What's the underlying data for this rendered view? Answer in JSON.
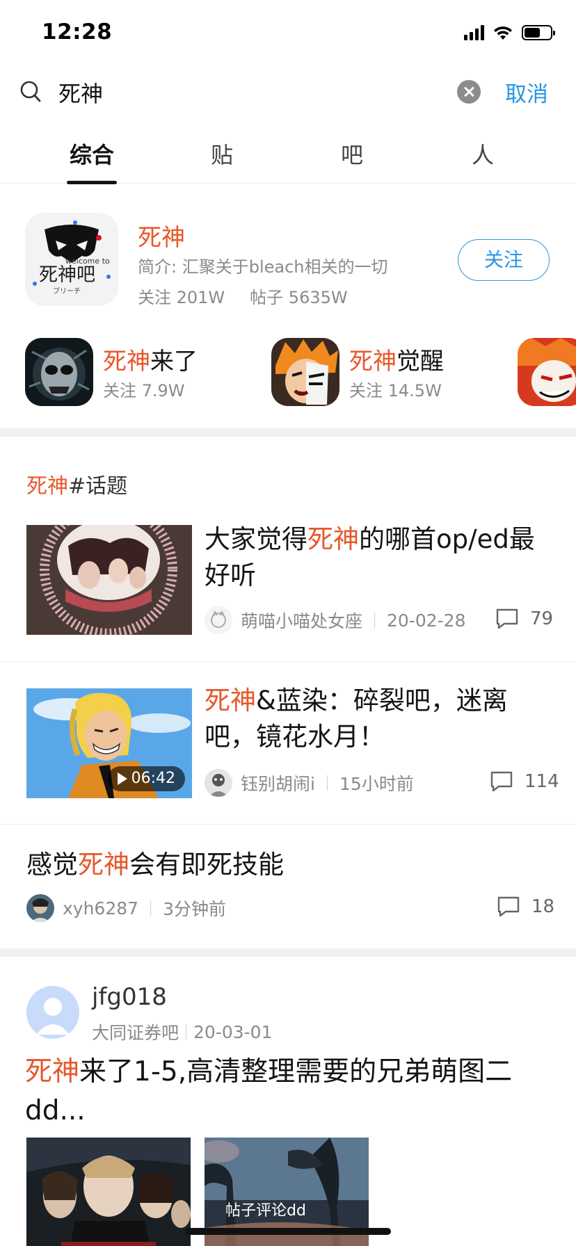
{
  "status_bar": {
    "time": "12:28"
  },
  "search": {
    "query": "死神",
    "cancel_label": "取消"
  },
  "tabs": [
    {
      "label": "综合",
      "active": true
    },
    {
      "label": "贴",
      "active": false
    },
    {
      "label": "吧",
      "active": false
    },
    {
      "label": "人",
      "active": false
    }
  ],
  "bar": {
    "name": "死神",
    "intro": "简介: 汇聚关于bleach相关的一切",
    "followers": "关注 201W",
    "posts": "帖子 5635W",
    "follow_label": "关注",
    "logo_text": "死神吧",
    "logo_welcome": "welcome to",
    "logo_sub": "ブリーチ"
  },
  "related_bars": [
    {
      "name_highlight": "死神",
      "name_rest": "来了",
      "followers": "关注 7.9W"
    },
    {
      "name_highlight": "死神",
      "name_rest": "觉醒",
      "followers": "关注 14.5W"
    }
  ],
  "topics": {
    "header_highlight": "死神",
    "header_rest": "#话题",
    "items": [
      {
        "title_pre": "大家觉得",
        "title_highlight": "死神",
        "title_post": "的哪首op/ed最好听",
        "author": "萌喵小喵处女座",
        "time": "20-02-28",
        "comments": "79"
      },
      {
        "title_pre": "",
        "title_highlight": "死神",
        "title_post": "&蓝染：碎裂吧，迷离吧，镜花水月！",
        "author": "钰别胡闹i",
        "time": "15小时前",
        "comments": "114",
        "duration": "06:42"
      },
      {
        "title_pre": "感觉",
        "title_highlight": "死神",
        "title_post": "会有即死技能",
        "author": "xyh6287",
        "time": "3分钟前",
        "comments": "18"
      }
    ]
  },
  "post": {
    "author": "jfg018",
    "bar": "大同证券吧",
    "date": "20-03-01",
    "title_highlight": "死神",
    "title_rest": "来了1-5,高清整理需要的兄弟萌图二dd...",
    "image2_caption": "帖子评论dd"
  },
  "colors": {
    "highlight": "#e8572a",
    "accent": "#2a95e6"
  }
}
